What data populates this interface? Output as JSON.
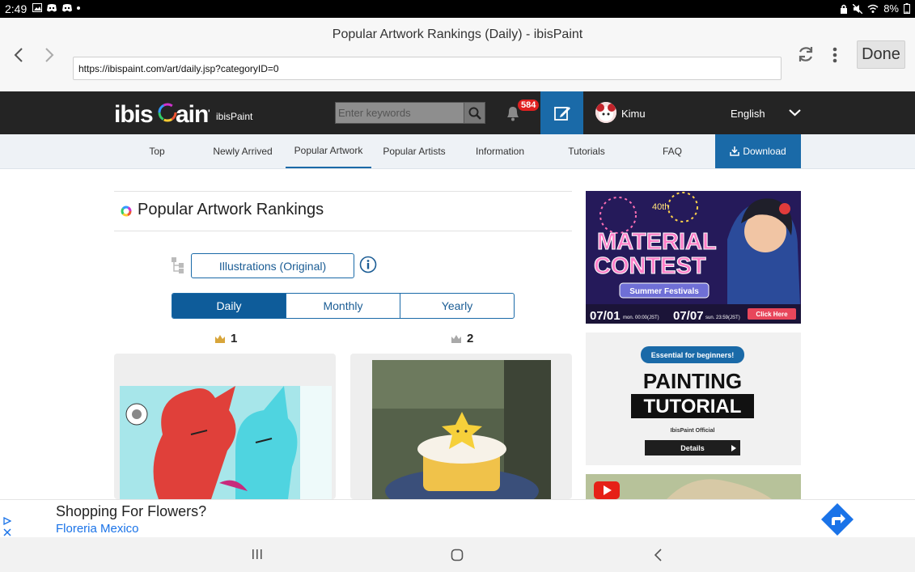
{
  "status_bar": {
    "time": "2:49",
    "battery": "8%"
  },
  "browser": {
    "title": "Popular Artwork Rankings (Daily) - ibisPaint",
    "url": "https://ibispaint.com/art/daily.jsp?categoryID=0",
    "done_label": "Done"
  },
  "site_header": {
    "logo_text": "ibisPaint",
    "logo_sub": "ibisPaint",
    "search_placeholder": "Enter keywords",
    "notification_count": "584",
    "username": "Kimu",
    "language": "English"
  },
  "nav": {
    "items": [
      "Top",
      "Newly Arrived",
      "Popular Artwork",
      "Popular Artists",
      "Information",
      "Tutorials",
      "FAQ"
    ],
    "active": "Popular Artwork",
    "download_label": "Download"
  },
  "main": {
    "heading": "Popular Artwork Rankings",
    "category": "Illustrations (Original)",
    "periods": [
      "Daily",
      "Monthly",
      "Yearly"
    ],
    "active_period": "Daily",
    "ranks": [
      "1",
      "2"
    ]
  },
  "sidebar": {
    "contest": {
      "edition": "40th",
      "title_line1": "MATERIAL",
      "title_line2": "CONTEST",
      "theme": "Summer Festivals",
      "start_date": "07/01",
      "start_meta": "mon. 00:00(JST)",
      "end_date": "07/07",
      "end_meta": "sun. 23:59(JST)",
      "cta": "Click Here"
    },
    "tutorial": {
      "badge": "Essential for beginners!",
      "title_line1": "PAINTING",
      "title_line2": "TUTORIAL",
      "brand": "IbisPaint Official",
      "cta": "Details"
    }
  },
  "bottom_ad": {
    "title": "Shopping For Flowers?",
    "advertiser": "Floreria Mexico"
  },
  "colors": {
    "brand_blue": "#1a6aa8",
    "header_dark": "#242424",
    "badge_red": "#e02020"
  }
}
